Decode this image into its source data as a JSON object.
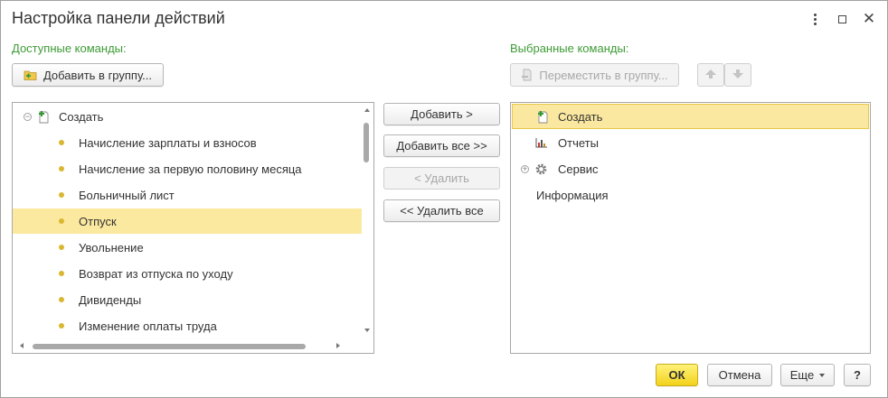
{
  "window": {
    "title": "Настройка панели действий",
    "more_label": "⋮",
    "maximize_label": "",
    "close_label": "✕"
  },
  "available": {
    "label": "Доступные команды:",
    "add_to_group": "Добавить в группу...",
    "root": "Создать",
    "items": [
      "Начисление зарплаты и взносов",
      "Начисление за первую половину месяца",
      "Больничный лист",
      "Отпуск",
      "Увольнение",
      "Возврат из отпуска по уходу",
      "Дивиденды",
      "Изменение оплаты труда"
    ],
    "selected_index": 3
  },
  "middle": {
    "add": "Добавить >",
    "add_all": "Добавить все >>",
    "remove": "< Удалить",
    "remove_all": "<< Удалить все"
  },
  "selected": {
    "label": "Выбранные команды:",
    "move_to_group": "Переместить в группу...",
    "items": [
      "Создать",
      "Отчеты",
      "Сервис",
      "Информация"
    ]
  },
  "footer": {
    "ok": "ОК",
    "cancel": "Отмена",
    "more": "Еще",
    "help": "?"
  },
  "colors": {
    "section_label": "#3d9b35",
    "selection": "#fbe9a0",
    "selection_border": "#e7c74a",
    "bullet": "#d9b731",
    "ok_button": "#f3d21c"
  }
}
